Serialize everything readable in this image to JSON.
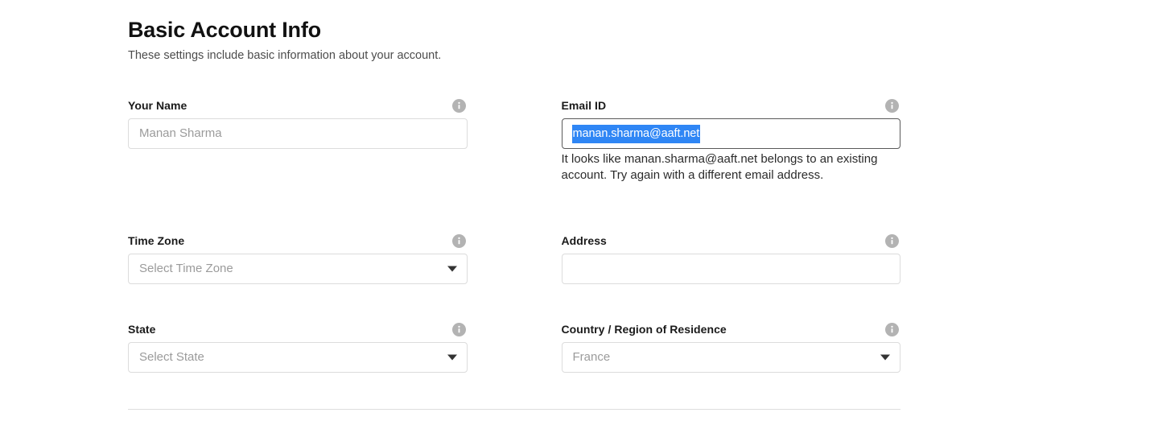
{
  "header": {
    "title": "Basic Account Info",
    "subtitle": "These settings include basic information about your account."
  },
  "icons": {
    "info": "info-icon",
    "dropdown": "chevron-down-icon"
  },
  "colors": {
    "selection_highlight": "#2f86f5",
    "selection_text": "#ffffff",
    "label_text": "#1a1a1a",
    "placeholder_text": "#9b9b9b",
    "error_text": "#2b2b2b",
    "input_border": "#dcdcdc",
    "input_border_focused": "#5a5a5a",
    "info_icon_bg": "#b3b3b3",
    "divider": "#dedede"
  },
  "fields": {
    "your_name": {
      "label": "Your Name",
      "placeholder": "Manan Sharma",
      "value": "",
      "type": "text"
    },
    "email_id": {
      "label": "Email ID",
      "placeholder": "",
      "value": "manan.sharma@aaft.net",
      "type": "text",
      "focused": true,
      "text_selected": true,
      "error": "It looks like manan.sharma@aaft.net belongs to an existing account. Try again with a different email address."
    },
    "time_zone": {
      "label": "Time Zone",
      "placeholder": "Select Time Zone",
      "value": "",
      "type": "select"
    },
    "address": {
      "label": "Address",
      "placeholder": "",
      "value": "",
      "type": "text"
    },
    "state": {
      "label": "State",
      "placeholder": "Select State",
      "value": "",
      "type": "select"
    },
    "country": {
      "label": "Country / Region of Residence",
      "placeholder": "",
      "value": "France",
      "type": "select"
    }
  }
}
